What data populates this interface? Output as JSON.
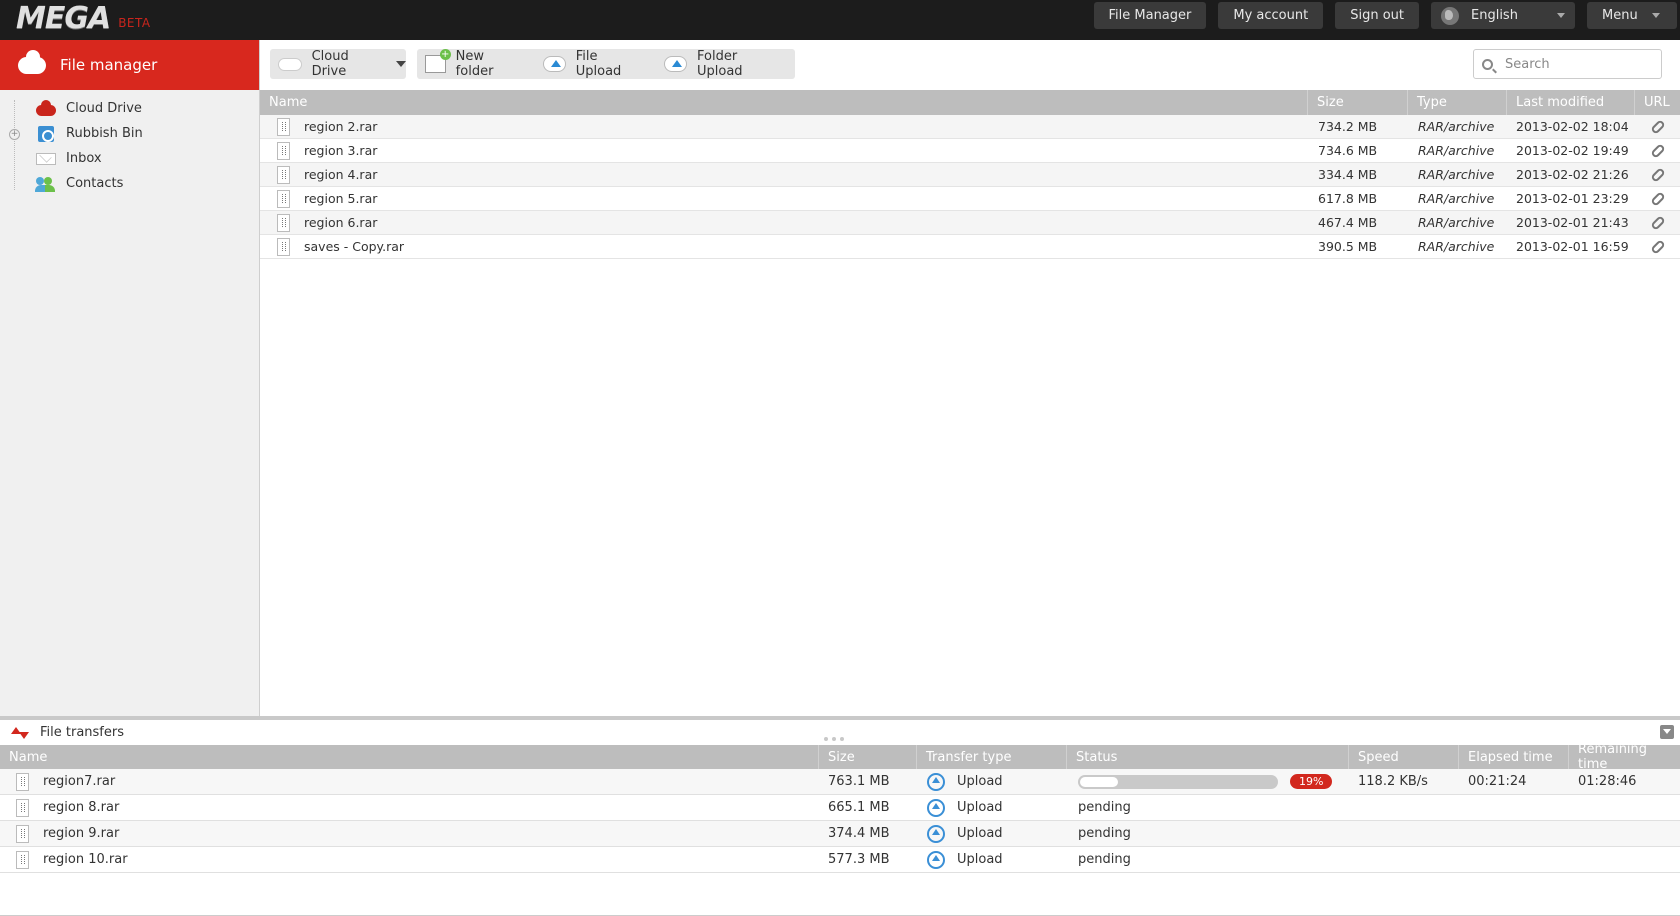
{
  "brand": {
    "logo": "MEGA",
    "badge": "BETA"
  },
  "topnav": {
    "file_manager": "File Manager",
    "my_account": "My account",
    "sign_out": "Sign out",
    "language": "English",
    "menu": "Menu"
  },
  "sidebar": {
    "header": "File manager",
    "items": [
      {
        "label": "Cloud Drive",
        "icon": "cloud-icon"
      },
      {
        "label": "Rubbish Bin",
        "icon": "rubbish-bin-icon"
      },
      {
        "label": "Inbox",
        "icon": "inbox-icon"
      },
      {
        "label": "Contacts",
        "icon": "contacts-icon"
      }
    ]
  },
  "toolbar": {
    "cloud_drive": "Cloud Drive",
    "new_folder": "New folder",
    "file_upload": "File Upload",
    "folder_upload": "Folder Upload",
    "search_placeholder": "Search"
  },
  "files": {
    "columns": {
      "name": "Name",
      "size": "Size",
      "type": "Type",
      "modified": "Last modified",
      "url": "URL"
    },
    "rows": [
      {
        "name": "region 2.rar",
        "size": "734.2 MB",
        "type": "RAR/archive",
        "modified": "2013-02-02 18:04"
      },
      {
        "name": "region 3.rar",
        "size": "734.6 MB",
        "type": "RAR/archive",
        "modified": "2013-02-02 19:49"
      },
      {
        "name": "region 4.rar",
        "size": "334.4 MB",
        "type": "RAR/archive",
        "modified": "2013-02-02 21:26"
      },
      {
        "name": "region 5.rar",
        "size": "617.8 MB",
        "type": "RAR/archive",
        "modified": "2013-02-01 23:29"
      },
      {
        "name": "region 6.rar",
        "size": "467.4 MB",
        "type": "RAR/archive",
        "modified": "2013-02-01 21:43"
      },
      {
        "name": "saves - Copy.rar",
        "size": "390.5 MB",
        "type": "RAR/archive",
        "modified": "2013-02-01 16:59"
      }
    ]
  },
  "transfers": {
    "title": "File transfers",
    "columns": {
      "name": "Name",
      "size": "Size",
      "type": "Transfer type",
      "status": "Status",
      "speed": "Speed",
      "elapsed": "Elapsed time",
      "remaining": "Remaining time"
    },
    "rows": [
      {
        "name": "region7.rar",
        "size": "763.1 MB",
        "type": "Upload",
        "status": "",
        "progress_percent": 19,
        "progress_label": "19%",
        "speed": "118.2 KB/s",
        "elapsed": "00:21:24",
        "remaining": "01:28:46"
      },
      {
        "name": "region 8.rar",
        "size": "665.1 MB",
        "type": "Upload",
        "status": "pending",
        "speed": "",
        "elapsed": "",
        "remaining": ""
      },
      {
        "name": "region 9.rar",
        "size": "374.4 MB",
        "type": "Upload",
        "status": "pending",
        "speed": "",
        "elapsed": "",
        "remaining": ""
      },
      {
        "name": "region 10.rar",
        "size": "577.3 MB",
        "type": "Upload",
        "status": "pending",
        "speed": "",
        "elapsed": "",
        "remaining": ""
      }
    ]
  },
  "colors": {
    "accent": "#d8281e",
    "topbar": "#1c1c1c",
    "header_gray": "#bdbdbd",
    "upload_blue": "#3a8fd6"
  }
}
